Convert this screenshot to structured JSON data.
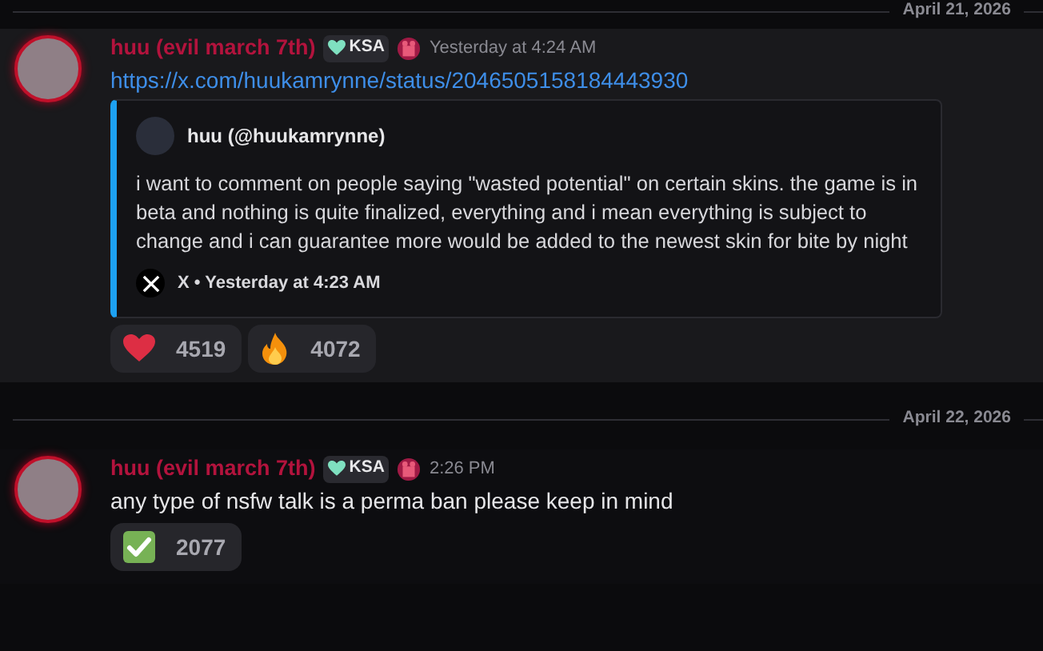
{
  "messages": [
    {
      "date": "April 21, 2026",
      "highlighted": true,
      "author": "huu (evil march 7th)",
      "tag": "KSA",
      "timestamp": "Yesterday at 4:24 AM",
      "link": "https://x.com/huukamrynne/status/2046505158184443930",
      "embed": {
        "author": "huu (@huukamrynne)",
        "text": "i want to comment on people saying \"wasted potential\" on certain skins. the game is in beta and nothing is quite finalized, everything and i mean everything is subject to change and i can guarantee more would be added to the newest skin for bite by night",
        "footer": "X • Yesterday at 4:23 AM"
      },
      "reactions": [
        {
          "kind": "heart",
          "count": "4519"
        },
        {
          "kind": "fire",
          "count": "4072"
        }
      ]
    },
    {
      "date": "April 22, 2026",
      "highlighted": false,
      "author": "huu (evil march 7th)",
      "tag": "KSA",
      "timestamp": "2:26 PM",
      "text": "any type of nsfw talk is a perma ban please keep in mind",
      "reactions": [
        {
          "kind": "check",
          "count": "2077"
        }
      ]
    }
  ]
}
